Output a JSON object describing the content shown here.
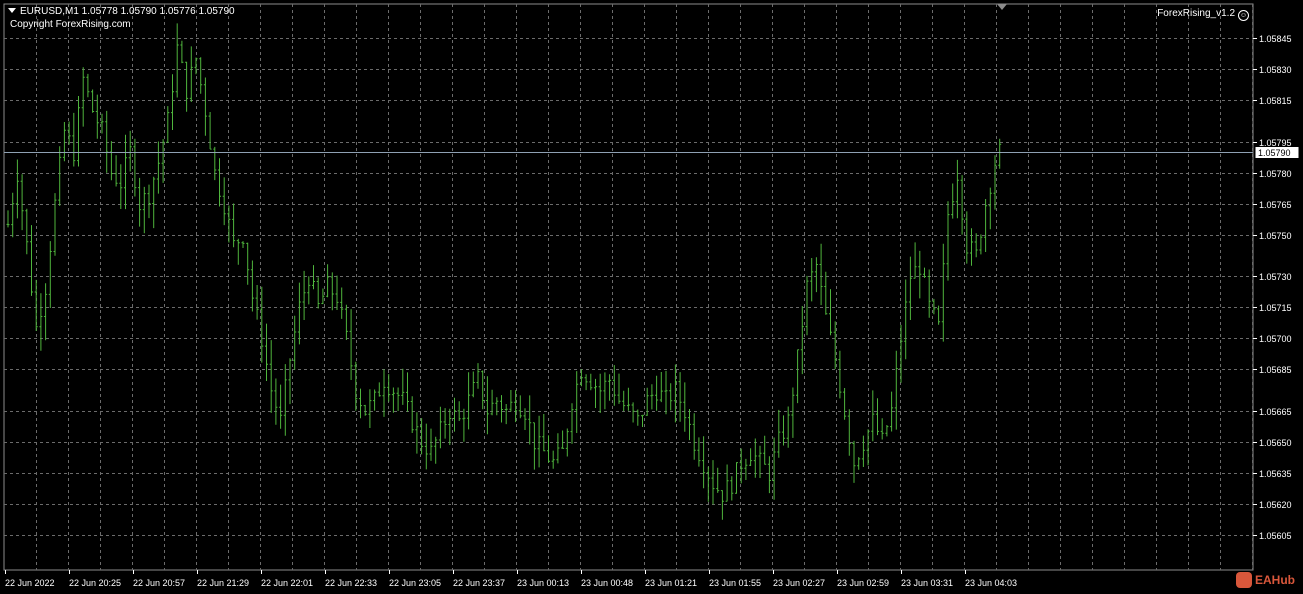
{
  "header": {
    "symbol_info": "EURUSD,M1  1.05778 1.05790 1.05776 1.05790",
    "copyright": "Copyright ForexRising.com",
    "ea_label": "ForexRising_v1.2"
  },
  "watermark": "EAHub",
  "colors": {
    "background": "#000000",
    "bars": "#4fb53d",
    "grid": "#6b6b6b",
    "axis_text": "#ffffff",
    "bid_line": "#8fa1b3"
  },
  "chart_data": {
    "type": "ohlc",
    "symbol": "EURUSD",
    "timeframe": "M1",
    "current_price": "1.05790",
    "y_ticks": [
      "1.05845",
      "1.05830",
      "1.05815",
      "1.05795",
      "1.05780",
      "1.05765",
      "1.05750",
      "1.05730",
      "1.05715",
      "1.05700",
      "1.05685",
      "1.05665",
      "1.05650",
      "1.05635",
      "1.05620",
      "1.05605"
    ],
    "ylim": [
      1.056,
      1.0585
    ],
    "x_ticks": [
      "22 Jun 2022",
      "22 Jun 20:25",
      "22 Jun 20:57",
      "22 Jun 21:29",
      "22 Jun 22:01",
      "22 Jun 22:33",
      "22 Jun 23:05",
      "22 Jun 23:37",
      "23 Jun 00:13",
      "23 Jun 00:48",
      "23 Jun 01:21",
      "23 Jun 01:55",
      "23 Jun 02:27",
      "23 Jun 02:59",
      "23 Jun 03:31",
      "23 Jun 04:03"
    ],
    "price_path": [
      [
        0,
        1.05755
      ],
      [
        2,
        1.0578
      ],
      [
        4,
        1.05745
      ],
      [
        6,
        1.05705
      ],
      [
        8,
        1.05725
      ],
      [
        10,
        1.05765
      ],
      [
        12,
        1.058
      ],
      [
        14,
        1.0579
      ],
      [
        16,
        1.05825
      ],
      [
        18,
        1.0581
      ],
      [
        20,
        1.058
      ],
      [
        22,
        1.0578
      ],
      [
        24,
        1.05775
      ],
      [
        26,
        1.0579
      ],
      [
        28,
        1.05765
      ],
      [
        30,
        1.0577
      ],
      [
        32,
        1.05785
      ],
      [
        34,
        1.05805
      ],
      [
        36,
        1.0584
      ],
      [
        38,
        1.0582
      ],
      [
        40,
        1.05835
      ],
      [
        42,
        1.0581
      ],
      [
        44,
        1.0578
      ],
      [
        46,
        1.05765
      ],
      [
        48,
        1.05745
      ],
      [
        50,
        1.0575
      ],
      [
        52,
        1.0572
      ],
      [
        54,
        1.057
      ],
      [
        56,
        1.05675
      ],
      [
        58,
        1.0566
      ],
      [
        60,
        1.0569
      ],
      [
        62,
        1.05715
      ],
      [
        64,
        1.0573
      ],
      [
        66,
        1.05715
      ],
      [
        68,
        1.05725
      ],
      [
        70,
        1.0572
      ],
      [
        72,
        1.057
      ],
      [
        74,
        1.05675
      ],
      [
        76,
        1.05665
      ],
      [
        78,
        1.0567
      ],
      [
        80,
        1.0568
      ],
      [
        82,
        1.05675
      ],
      [
        84,
        1.0567
      ],
      [
        86,
        1.0566
      ],
      [
        88,
        1.0565
      ],
      [
        90,
        1.05645
      ],
      [
        92,
        1.05655
      ],
      [
        94,
        1.05665
      ],
      [
        96,
        1.0566
      ],
      [
        98,
        1.0567
      ],
      [
        100,
        1.0568
      ],
      [
        102,
        1.05665
      ],
      [
        104,
        1.0567
      ],
      [
        106,
        1.05665
      ],
      [
        108,
        1.0567
      ],
      [
        110,
        1.05665
      ],
      [
        112,
        1.0565
      ],
      [
        114,
        1.05645
      ],
      [
        116,
        1.0564
      ],
      [
        118,
        1.05645
      ],
      [
        120,
        1.0567
      ],
      [
        122,
        1.05685
      ],
      [
        124,
        1.0568
      ],
      [
        126,
        1.05675
      ],
      [
        128,
        1.0568
      ],
      [
        130,
        1.0567
      ],
      [
        132,
        1.05665
      ],
      [
        134,
        1.0566
      ],
      [
        136,
        1.0567
      ],
      [
        138,
        1.05675
      ],
      [
        140,
        1.0567
      ],
      [
        142,
        1.05675
      ],
      [
        144,
        1.05665
      ],
      [
        146,
        1.0565
      ],
      [
        148,
        1.0564
      ],
      [
        150,
        1.0563
      ],
      [
        152,
        1.05625
      ],
      [
        154,
        1.0563
      ],
      [
        156,
        1.0564
      ],
      [
        158,
        1.05645
      ],
      [
        160,
        1.0564
      ],
      [
        162,
        1.05635
      ],
      [
        164,
        1.0565
      ],
      [
        166,
        1.0566
      ],
      [
        168,
        1.0569
      ],
      [
        170,
        1.05725
      ],
      [
        172,
        1.05735
      ],
      [
        174,
        1.0571
      ],
      [
        176,
        1.0569
      ],
      [
        178,
        1.05665
      ],
      [
        180,
        1.0564
      ],
      [
        182,
        1.0565
      ],
      [
        184,
        1.0566
      ],
      [
        186,
        1.0565
      ],
      [
        188,
        1.05665
      ],
      [
        190,
        1.057
      ],
      [
        192,
        1.0573
      ],
      [
        194,
        1.05735
      ],
      [
        196,
        1.05715
      ],
      [
        198,
        1.05705
      ],
      [
        200,
        1.0576
      ],
      [
        202,
        1.0578
      ],
      [
        204,
        1.05745
      ],
      [
        206,
        1.0574
      ],
      [
        208,
        1.05765
      ],
      [
        210,
        1.05785
      ],
      [
        211,
        1.0579
      ]
    ]
  }
}
